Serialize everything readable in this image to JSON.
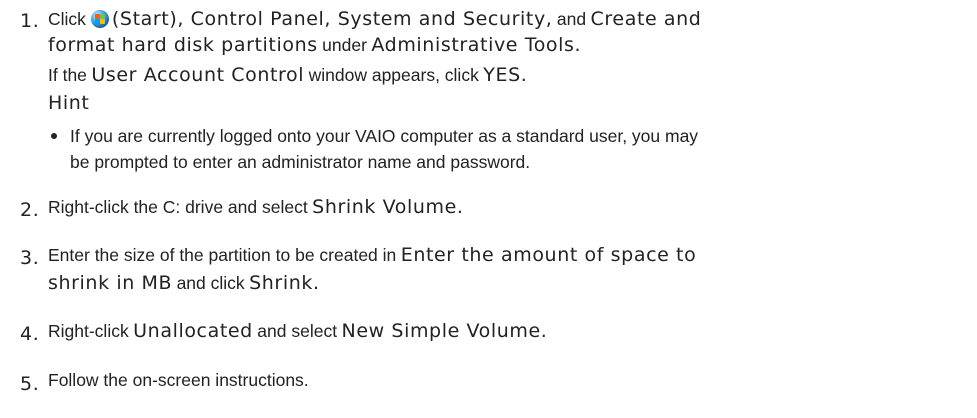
{
  "steps": [
    {
      "number": "1.",
      "line1": {
        "click": "Click",
        "start": "(Start), Control Panel, System and Security,",
        "and": "and",
        "create": "Create and"
      },
      "line2": {
        "format": "format hard disk partitions",
        "under": "under",
        "admin": "Administrative Tools."
      },
      "line3": {
        "if_the": "If the",
        "uac": "User Account Control",
        "window": "window appears, click",
        "yes": "YES."
      },
      "hint_title": "Hint",
      "hint_items": [
        {
          "line1": "If you are currently logged onto your VAIO computer as a standard user, you may",
          "line2": "be prompted to enter an administrator name and password."
        }
      ]
    },
    {
      "number": "2.",
      "pre": "Right-click the C: drive and select",
      "ui": "Shrink Volume."
    },
    {
      "number": "3.",
      "pre": "Enter the size of the partition to be created in",
      "ui_line1": "Enter the amount of space to",
      "ui_line2": "shrink in MB",
      "and_click": "and click",
      "ui_end": "Shrink."
    },
    {
      "number": "4.",
      "pre": "Right-click",
      "ui1": "Unallocated",
      "mid": "and select",
      "ui2": "New Simple Volume."
    },
    {
      "number": "5.",
      "text": "Follow the on-screen instructions."
    }
  ],
  "icons": {
    "start": "windows-start-orb-icon",
    "bullet": "bullet-icon"
  }
}
